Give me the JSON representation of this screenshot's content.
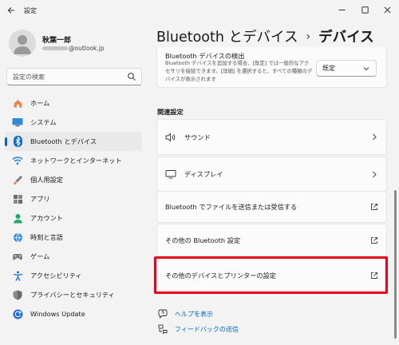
{
  "window": {
    "app_title": "設定"
  },
  "user": {
    "name": "秋葉一郎",
    "email_suffix": "@outlook.jp"
  },
  "search": {
    "placeholder": "設定の検索"
  },
  "sidebar": {
    "items": [
      {
        "label": "ホーム",
        "icon": "home-icon"
      },
      {
        "label": "システム",
        "icon": "system-icon"
      },
      {
        "label": "Bluetooth とデバイス",
        "icon": "bluetooth-icon",
        "active": true
      },
      {
        "label": "ネットワークとインターネット",
        "icon": "network-icon"
      },
      {
        "label": "個人用設定",
        "icon": "personalization-icon"
      },
      {
        "label": "アプリ",
        "icon": "apps-icon"
      },
      {
        "label": "アカウント",
        "icon": "account-icon"
      },
      {
        "label": "時刻と言語",
        "icon": "time-language-icon"
      },
      {
        "label": "ゲーム",
        "icon": "gaming-icon"
      },
      {
        "label": "アクセシビリティ",
        "icon": "accessibility-icon"
      },
      {
        "label": "プライバシーとセキュリティ",
        "icon": "privacy-shield-icon"
      },
      {
        "label": "Windows Update",
        "icon": "windows-update-icon"
      }
    ]
  },
  "header": {
    "breadcrumb_parent": "Bluetooth とデバイス",
    "breadcrumb_separator": "›",
    "breadcrumb_current": "デバイス"
  },
  "discovery": {
    "title": "Bluetooth デバイスの検出",
    "description": "Bluetooth デバイスを追加する場合、[既定] では一般的なアクセサリを接続できます。[詳細] を選択すると、すべての種類のデバイスが表示されます",
    "selected": "既定"
  },
  "related": {
    "heading": "関連設定",
    "items": [
      {
        "label": "サウンド",
        "icon": "speaker-icon",
        "end_icon": "chevron-right-icon"
      },
      {
        "label": "ディスプレイ",
        "icon": "monitor-icon",
        "end_icon": "chevron-right-icon"
      },
      {
        "label": "Bluetooth でファイルを送信または受信する",
        "icon": "",
        "end_icon": "external-link-icon"
      },
      {
        "label": "その他の Bluetooth 設定",
        "icon": "",
        "end_icon": "external-link-icon"
      },
      {
        "label": "その他のデバイスとプリンターの設定",
        "icon": "",
        "end_icon": "external-link-icon",
        "highlighted": true
      }
    ]
  },
  "help": {
    "get_help": "ヘルプを表示",
    "feedback": "フィードバックの送信"
  },
  "colors": {
    "accent": "#0067c0",
    "highlight": "#e8001a",
    "background": "#f3f3f3",
    "card": "#fbfbfb"
  }
}
